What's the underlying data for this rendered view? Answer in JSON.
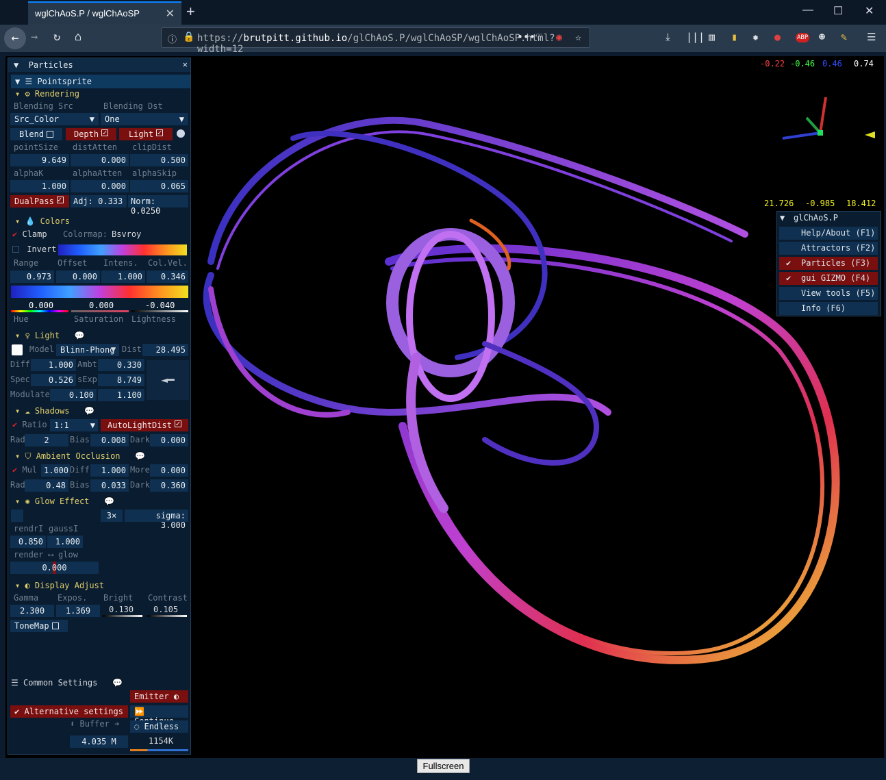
{
  "browser": {
    "tab_title": "wglChAoS.P / wglChAoSP",
    "url_prefix": "https://",
    "url_domain": "brutpitt.github.io",
    "url_path": "/glChAoS.P/wglChAoSP/wglChAoSP.html?width=12"
  },
  "panel": {
    "title": "Particles",
    "sub": "Pointsprite",
    "rendering": {
      "title": "Rendering",
      "blend_src_label": "Blending Src",
      "blend_dst_label": "Blending Dst",
      "blend_src": "Src_Color",
      "blend_dst": "One",
      "blend": "Blend",
      "depth": "Depth",
      "light": "Light",
      "labels1": [
        "pointSize",
        "distAtten",
        "clipDist"
      ],
      "vals1": [
        "9.649",
        "0.000",
        "0.500"
      ],
      "labels2": [
        "alphaK",
        "alphaAtten",
        "alphaSkip"
      ],
      "vals2": [
        "1.000",
        "0.000",
        "0.065"
      ],
      "dualpass": "DualPass",
      "adj": "Adj: 0.333",
      "norm": "Norm: 0.0250"
    },
    "colors": {
      "title": "Colors",
      "clamp": "Clamp",
      "colormap_label": "Colormap:",
      "colormap": "Bsvroy",
      "invert": "Invert",
      "labels": [
        "Range",
        "Offset",
        "Intens.",
        "Col.Vel."
      ],
      "vals": [
        "0.973",
        "0.000",
        "1.000",
        "0.346"
      ],
      "hsl_vals": [
        "0.000",
        "0.000",
        "-0.040"
      ],
      "hsl_labels": [
        "Hue",
        "Saturation",
        "Lightness"
      ]
    },
    "light": {
      "title": "Light",
      "model_label": "Model",
      "model": "Blinn-Phong",
      "dist_label": "Dist",
      "dist": "28.495",
      "diff_label": "Diff",
      "diff": "1.000",
      "ambt_label": "Ambt",
      "ambt": "0.330",
      "spec_label": "Spec",
      "spec": "0.526",
      "sexp_label": "sExp",
      "sexp": "8.749",
      "mod_label": "Modulate",
      "mod1": "0.100",
      "mod2": "1.100"
    },
    "shadows": {
      "title": "Shadows",
      "ratio_label": "Ratio",
      "ratio": "1:1",
      "autolight": "AutoLightDist",
      "rad_label": "Rad",
      "rad": "2",
      "bias_label": "Bias",
      "bias": "0.008",
      "dark_label": "Dark",
      "dark": "0.000"
    },
    "ao": {
      "title": "Ambient Occlusion",
      "mul_label": "Mul",
      "mul": "1.000",
      "diff_label": "Diff",
      "diff": "1.000",
      "more_label": "More",
      "more": "0.000",
      "rad_label": "Rad",
      "rad": "0.48",
      "bias_label": "Bias",
      "bias": "0.033",
      "dark_label": "Dark",
      "dark": "0.360"
    },
    "glow": {
      "title": "Glow Effect",
      "mult": "3×",
      "sigma": "sigma: 3.000",
      "rendr_label": "rendrI",
      "gauss_label": "gaussI",
      "rendr": "0.850",
      "gauss": "1.000",
      "mix_label": "render ⟷ glow",
      "mix": "0.000"
    },
    "display": {
      "title": "Display Adjust",
      "labels": [
        "Gamma",
        "Expos.",
        "Bright",
        "Contrast"
      ],
      "vals": [
        "2.300",
        "1.369",
        "0.130",
        "0.105"
      ],
      "tonemap": "ToneMap"
    },
    "common": {
      "title": "Common Settings",
      "emitter": "Emitter",
      "alt": "Alternative settings",
      "continue": "Continue",
      "buffer": "Buffer",
      "endless": "Endless",
      "buffer_val": "4.035 M",
      "count": "1154K"
    }
  },
  "hud": {
    "rgb": [
      "-0.22",
      "-0.46",
      "0.46",
      "0.74"
    ],
    "pos": [
      "21.726",
      "-0.985",
      "18.412"
    ]
  },
  "menu": {
    "title": "glChAoS.P",
    "items": [
      {
        "label": "Help/About (F1)",
        "on": false
      },
      {
        "label": "Attractors (F2)",
        "on": false
      },
      {
        "label": "Particles (F3)",
        "on": true
      },
      {
        "label": "gui GIZMO (F4)",
        "on": true
      },
      {
        "label": "View tools (F5)",
        "on": false
      },
      {
        "label": "Info (F6)",
        "on": false
      }
    ]
  },
  "fullscreen": "Fullscreen",
  "colors": {
    "accent_red": "#7a0f0f",
    "accent_blue": "#0f3050",
    "header": "#e0cf6a"
  }
}
